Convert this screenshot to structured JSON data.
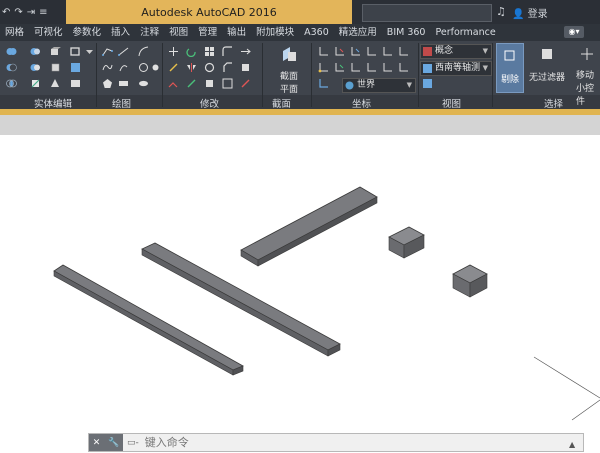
{
  "app": {
    "title": "Autodesk AutoCAD 2016",
    "search_value": "",
    "signin": "登录",
    "quick_access": [
      "↶",
      "↷",
      "⇥",
      "≡"
    ],
    "binoculars": "♫"
  },
  "tabs": [
    "网格",
    "可视化",
    "参数化",
    "插入",
    "注释",
    "视图",
    "管理",
    "输出",
    "附加模块",
    "A360",
    "精选应用",
    "BIM 360",
    "Performance"
  ],
  "active_tab_index": -1,
  "ribbon": {
    "panels": [
      "实体编辑",
      "绘图",
      "修改",
      "截面",
      "坐标",
      "视图",
      "选择"
    ],
    "section_plane_label_1": "截面",
    "section_plane_label_2": "平面",
    "visual_style": "概念",
    "view_direction": "西南等轴测",
    "ucs": "世界",
    "cull_label": "剔除",
    "no_filter_label": "无过滤器",
    "move_gizmo_label_1": "移动",
    "move_gizmo_label_2": "小控件"
  },
  "command_line": {
    "placeholder": "键入命令",
    "close": "✕",
    "settings": "🔧"
  },
  "colors": {
    "title_accent": "#e3b55a",
    "ribbon_bg": "#3f444c",
    "solid_fill": "#7a7b7f"
  }
}
